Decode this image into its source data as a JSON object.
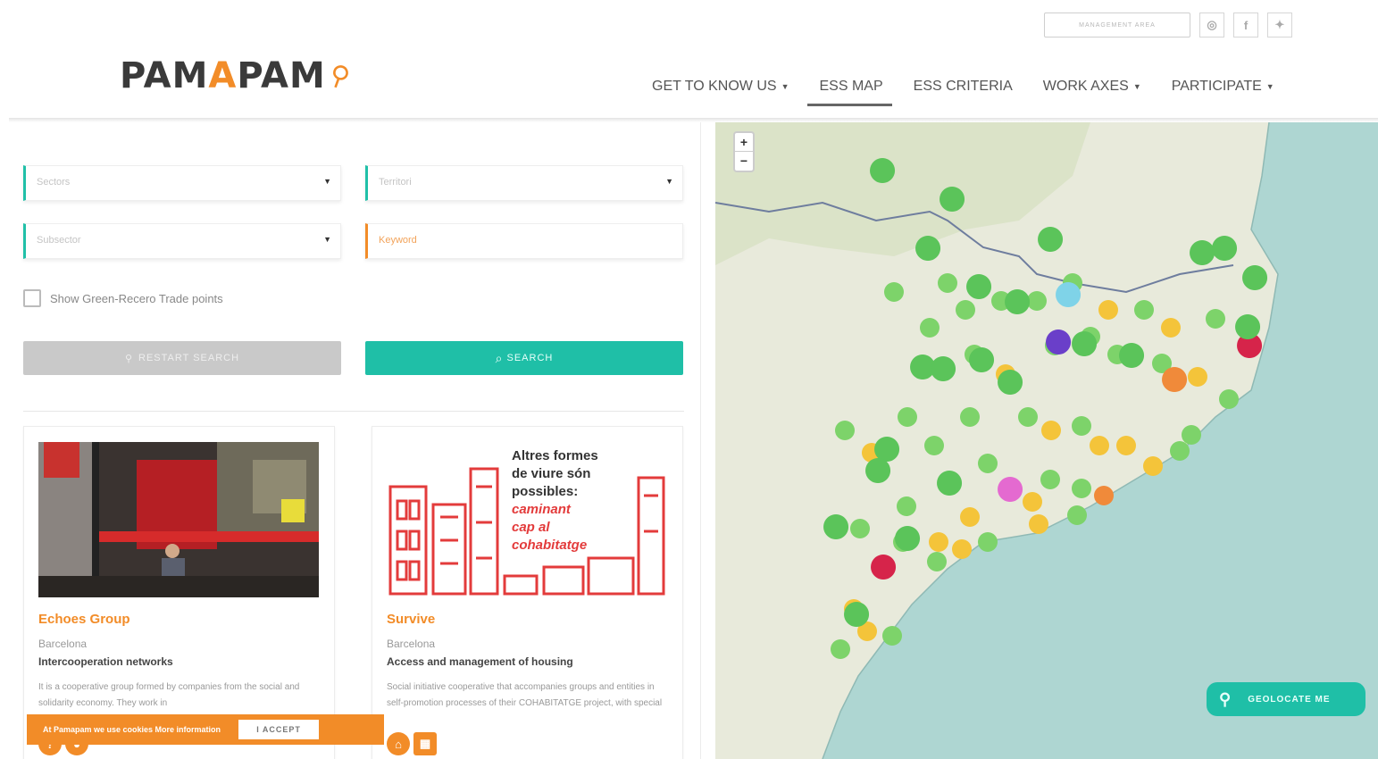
{
  "header": {
    "management_label": "MANAGEMENT AREA",
    "social": [
      {
        "name": "instagram-icon",
        "glyph": "◎"
      },
      {
        "name": "facebook-icon",
        "glyph": "f"
      },
      {
        "name": "twitter-icon",
        "glyph": "✦"
      }
    ],
    "logo": {
      "part1": "PAM",
      "part2": "A",
      "part3": "PAM",
      "pin": "⚲"
    },
    "nav": [
      {
        "label": "GET TO KNOW US",
        "dropdown": true
      },
      {
        "label": "ESS MAP",
        "active": true
      },
      {
        "label": "ESS CRITERIA"
      },
      {
        "label": "WORK AXES",
        "dropdown": true
      },
      {
        "label": "PARTICIPATE",
        "dropdown": true
      }
    ]
  },
  "filters": {
    "sector": "Sectors",
    "territory": "Territori",
    "subsector": "Subsector",
    "keyword_placeholder": "Keyword",
    "checkbox_label": "Show Green-Recero Trade points",
    "restart_label": "RESTART SEARCH",
    "search_label": "SEARCH"
  },
  "cards": [
    {
      "title": "Echoes Group",
      "city": "Barcelona",
      "category": "Intercooperation networks",
      "description": "It is a cooperative group formed by companies from the social and solidarity economy. They work in"
    },
    {
      "title": "Survive",
      "city": "Barcelona",
      "category": "Access and management of housing",
      "description": "Social initiative cooperative that accompanies groups and entities in self-promotion processes of their COHABITATGE project, with special",
      "poster_lines": [
        "Altres formes",
        "de viure són",
        "possibles:",
        "caminant",
        "cap al",
        "cohabitatge"
      ]
    }
  ],
  "cookie": {
    "text": "At Pamapam we use cookies More information",
    "accept": "I ACCEPT"
  },
  "map": {
    "zoom_in": "+",
    "zoom_out": "−",
    "geolocate": "GEOLOCATE ME",
    "colors": {
      "sea": "#aed6d2",
      "land": "#e8eadb",
      "green": "#7dd36a",
      "yellow": "#f4c43a",
      "orange": "#f08a3a"
    }
  }
}
